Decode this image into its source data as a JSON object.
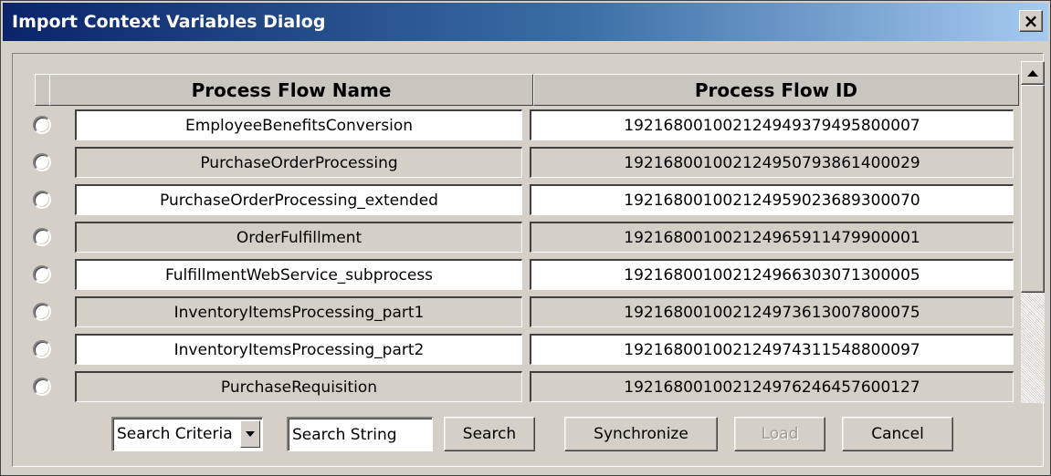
{
  "window": {
    "title": "Import Context Variables Dialog",
    "close_label": "×"
  },
  "table": {
    "columns": [
      "Process Flow Name",
      "Process Flow ID"
    ],
    "rows": [
      {
        "name": "EmployeeBenefitsConversion",
        "id": "19216800100212494937949580000 7"
      },
      {
        "name": "PurchaseOrderProcessing",
        "id": "192168001002124950793861400029"
      },
      {
        "name": "PurchaseOrderProcessing_extended",
        "id": "192168001002124959023689300070"
      },
      {
        "name": "OrderFulfillment",
        "id": "192168001002124965911479900001"
      },
      {
        "name": "FulfillmentWebService_subprocess",
        "id": "192168001002124966303071300005"
      },
      {
        "name": "InventoryItemsProcessing_part1",
        "id": "192168001002124973613007800075"
      },
      {
        "name": "InventoryItemsProcessing_part2",
        "id": "192168001002124974311548800097"
      },
      {
        "name": "PurchaseRequisition",
        "id": "192168001002124976246457600127"
      }
    ]
  },
  "controls": {
    "search_criteria": "Search Criteria",
    "search_string": "Search String",
    "search_label": "Search",
    "synchronize_label": "Synchronize",
    "load_label": "Load",
    "cancel_label": "Cancel"
  },
  "colors": {
    "title_gradient_start": "#0a246a",
    "title_gradient_end": "#a6caf0",
    "dialog_face": "#d4d0c8"
  }
}
